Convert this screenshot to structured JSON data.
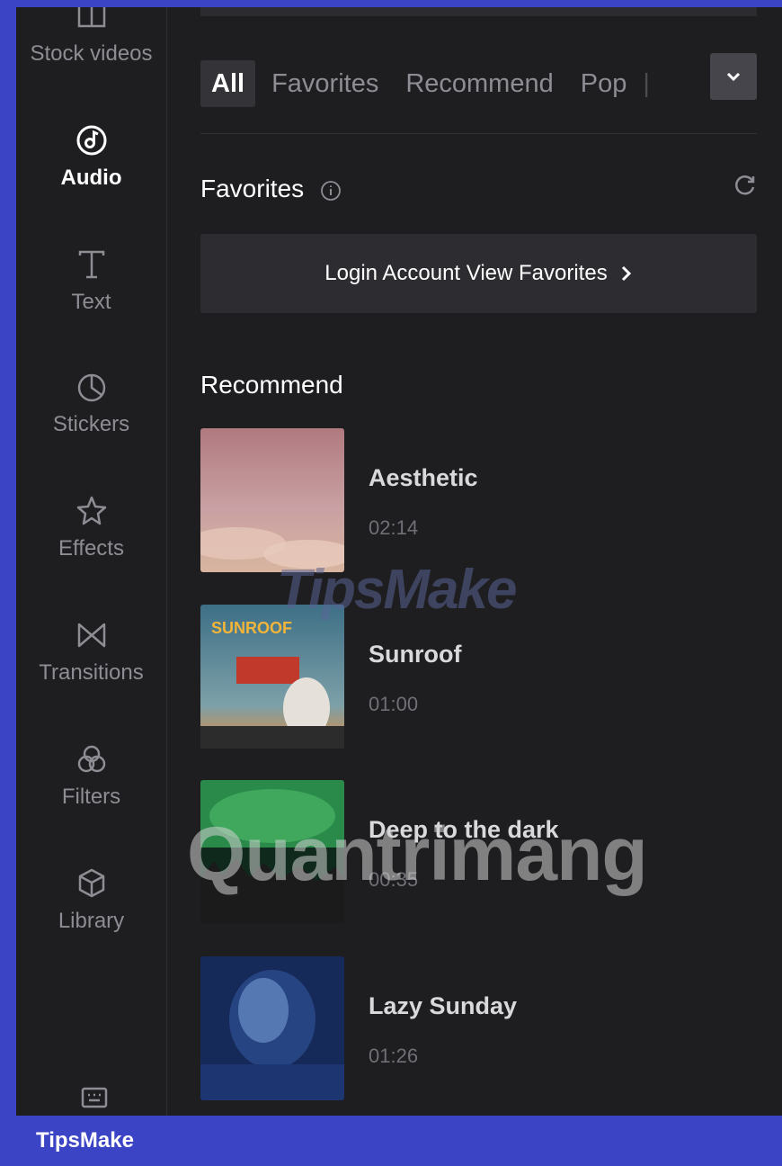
{
  "sidebar": {
    "items": [
      {
        "label": "Stock videos",
        "icon": "stock-videos-icon"
      },
      {
        "label": "Audio",
        "icon": "audio-icon",
        "active": true
      },
      {
        "label": "Text",
        "icon": "text-icon"
      },
      {
        "label": "Stickers",
        "icon": "stickers-icon"
      },
      {
        "label": "Effects",
        "icon": "effects-icon"
      },
      {
        "label": "Transitions",
        "icon": "transitions-icon"
      },
      {
        "label": "Filters",
        "icon": "filters-icon"
      },
      {
        "label": "Library",
        "icon": "library-icon"
      }
    ]
  },
  "tabs": [
    {
      "label": "All",
      "active": true
    },
    {
      "label": "Favorites"
    },
    {
      "label": "Recommend"
    },
    {
      "label": "Pop"
    }
  ],
  "favorites": {
    "title": "Favorites",
    "login_text": "Login Account View Favorites"
  },
  "recommend": {
    "title": "Recommend",
    "tracks": [
      {
        "title": "Aesthetic",
        "duration": "02:14"
      },
      {
        "title": "Sunroof",
        "duration": "01:00",
        "cover_text": "SUNROOF"
      },
      {
        "title": "Deep to the dark",
        "duration": "00:35"
      },
      {
        "title": "Lazy Sunday",
        "duration": "01:26"
      }
    ]
  },
  "watermarks": {
    "tipsmake": "TipsMake",
    "quantrimang": "Quantrimang"
  },
  "footer": {
    "brand": "TipsMake"
  },
  "colors": {
    "background": "#1e1e21",
    "frame": "#3b44c4",
    "active_tab": "#333338"
  }
}
